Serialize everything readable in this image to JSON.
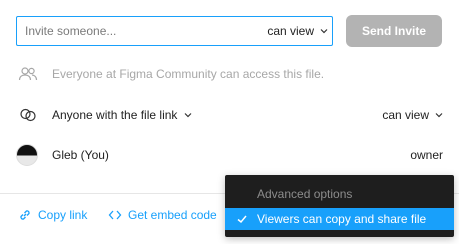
{
  "invite": {
    "placeholder": "Invite someone...",
    "permission": "can view",
    "send_label": "Send Invite"
  },
  "access": {
    "community_text": "Everyone at Figma Community can access this file.",
    "link_label": "Anyone with the file link",
    "link_permission": "can view"
  },
  "user": {
    "name": "Gleb (You)",
    "role": "owner"
  },
  "footer": {
    "copy_link": "Copy link",
    "embed_code": "Get embed code"
  },
  "menu": {
    "header": "Advanced options",
    "item": "Viewers can copy and share file",
    "item_checked": true
  },
  "colors": {
    "accent": "#18a0fb",
    "button_disabled": "#b3b3b3",
    "menu_bg": "#1e1e1e"
  }
}
